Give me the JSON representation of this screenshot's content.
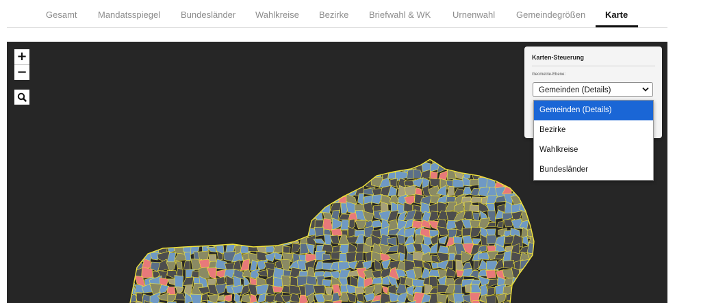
{
  "tabs": [
    {
      "label": "Gesamt"
    },
    {
      "label": "Mandatsspiegel"
    },
    {
      "label": "Bundesländer"
    },
    {
      "label": "Wahlkreise"
    },
    {
      "label": "Bezirke"
    },
    {
      "label": "Briefwahl & WK"
    },
    {
      "label": "Urnenwahl"
    },
    {
      "label": "Gemeindegrößen"
    },
    {
      "label": "Karte"
    }
  ],
  "active_tab": "Karte",
  "map": {
    "background_color": "#262626",
    "region_colors": [
      "#6f99c4",
      "#e8797a",
      "#4d4d4d",
      "#8a8a63",
      "#5b6f88",
      "#a6a07a"
    ],
    "border_color": "#f1e33a",
    "zoom_in_label": "+",
    "zoom_out_label": "−",
    "search_icon": "search-icon"
  },
  "control_panel": {
    "title": "Karten-Steuerung",
    "geometry_label": "Geometrie-Ebene:",
    "selected_value": "Gemeinden (Details)",
    "options": [
      {
        "label": "Gemeinden (Details)"
      },
      {
        "label": "Bezirke"
      },
      {
        "label": "Wahlkreise"
      },
      {
        "label": "Bundesländer"
      }
    ],
    "highlight_color": "#1a66d6"
  }
}
